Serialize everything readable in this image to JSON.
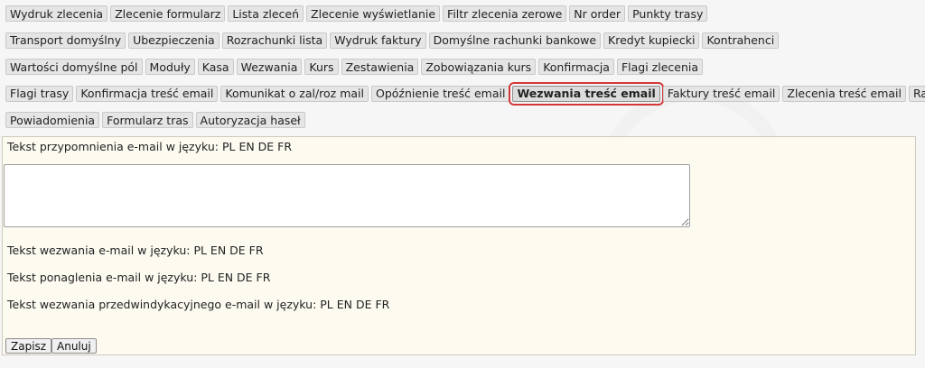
{
  "tabs_rows": [
    [
      "Wydruk zlecenia",
      "Zlecenie formularz",
      "Lista zleceń",
      "Zlecenie wyświetlanie",
      "Filtr zlecenia zerowe",
      "Nr order",
      "Punkty trasy"
    ],
    [
      "Transport domyślny",
      "Ubezpieczenia",
      "Rozrachunki lista",
      "Wydruk faktury",
      "Domyślne rachunki bankowe",
      "Kredyt kupiecki",
      "Kontrahenci"
    ],
    [
      "Wartości domyślne pól",
      "Moduły",
      "Kasa",
      "Wezwania",
      "Kurs",
      "Zestawienia",
      "Zobowiązania kurs",
      "Konfirmacja",
      "Flagi zlecenia"
    ],
    [
      "Flagi trasy",
      "Konfirmacja treść email",
      "Komunikat o zal/roz mail",
      "Opóźnienie treść email",
      "Wezwania treść email",
      "Faktury treść email",
      "Zlecenia treść email",
      "Raport"
    ],
    [
      "Powiadomienia",
      "Formularz tras",
      "Autoryzacja haseł"
    ]
  ],
  "active_tab": "Wezwania treść email",
  "form": {
    "reminder_label": "Tekst przypomnienia e-mail w języku: PL EN DE FR",
    "reminder_value": "",
    "summons_label": "Tekst wezwania e-mail w języku: PL EN DE FR",
    "urge_label": "Tekst ponaglenia e-mail w języku: PL EN DE FR",
    "precollection_label": "Tekst wezwania przedwindykacyjnego e-mail w języku: PL EN DE FR",
    "save_label": "Zapisz",
    "cancel_label": "Anuluj"
  }
}
